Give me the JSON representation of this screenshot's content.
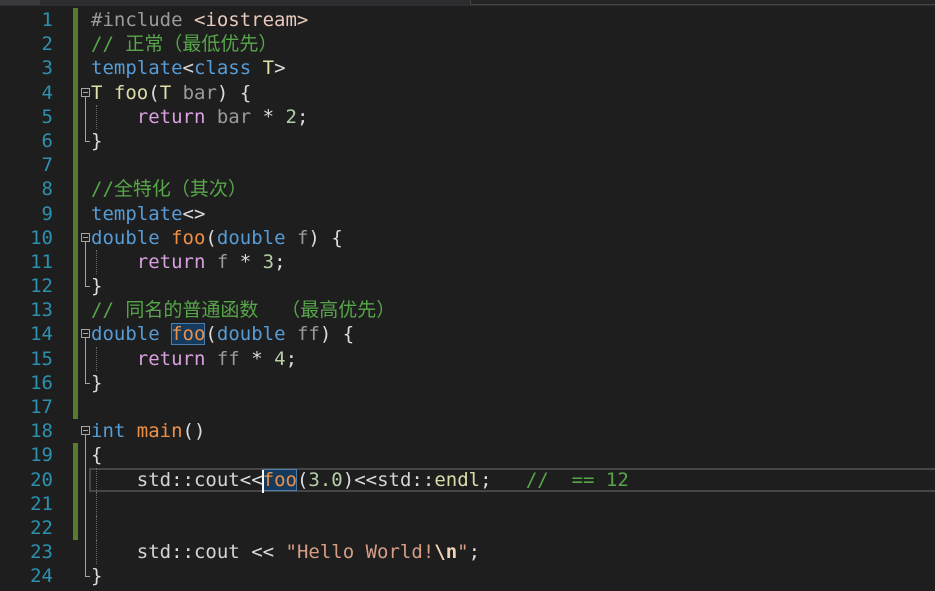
{
  "editor": {
    "lines": [
      {
        "num": "1",
        "changed": true,
        "tokens": [
          {
            "t": "#include",
            "c": "preproc"
          },
          {
            "t": " ",
            "c": "space"
          },
          {
            "t": "<iostream>",
            "c": "include"
          }
        ]
      },
      {
        "num": "2",
        "changed": true,
        "tokens": [
          {
            "t": "// 正常（最低优先）",
            "c": "comment"
          }
        ]
      },
      {
        "num": "3",
        "changed": true,
        "tokens": [
          {
            "t": "template",
            "c": "keyword"
          },
          {
            "t": "<",
            "c": "punct"
          },
          {
            "t": "class",
            "c": "keyword"
          },
          {
            "t": " ",
            "c": "space"
          },
          {
            "t": "T",
            "c": "typeparam"
          },
          {
            "t": ">",
            "c": "punct"
          }
        ]
      },
      {
        "num": "4",
        "changed": true,
        "outline": "start",
        "tokens": [
          {
            "t": "T",
            "c": "typeparam"
          },
          {
            "t": " ",
            "c": "space"
          },
          {
            "t": "foo",
            "c": "function"
          },
          {
            "t": "(",
            "c": "punct"
          },
          {
            "t": "T",
            "c": "typeparam"
          },
          {
            "t": " ",
            "c": "space"
          },
          {
            "t": "bar",
            "c": "param"
          },
          {
            "t": ")",
            "c": "punct"
          },
          {
            "t": " ",
            "c": "space"
          },
          {
            "t": "{",
            "c": "punct"
          }
        ]
      },
      {
        "num": "5",
        "changed": true,
        "outline": "mid",
        "guide": true,
        "tokens": [
          {
            "t": "    ",
            "c": "space"
          },
          {
            "t": "return",
            "c": "control"
          },
          {
            "t": " ",
            "c": "space"
          },
          {
            "t": "bar",
            "c": "param"
          },
          {
            "t": " ",
            "c": "space"
          },
          {
            "t": "*",
            "c": "punct"
          },
          {
            "t": " ",
            "c": "space"
          },
          {
            "t": "2",
            "c": "number"
          },
          {
            "t": ";",
            "c": "punct"
          }
        ]
      },
      {
        "num": "6",
        "changed": true,
        "outline": "end",
        "tokens": [
          {
            "t": "}",
            "c": "punct"
          }
        ]
      },
      {
        "num": "7",
        "changed": true,
        "tokens": []
      },
      {
        "num": "8",
        "changed": true,
        "tokens": [
          {
            "t": "//全特化（其次）",
            "c": "comment"
          }
        ]
      },
      {
        "num": "9",
        "changed": true,
        "tokens": [
          {
            "t": "template",
            "c": "keyword"
          },
          {
            "t": "<>",
            "c": "punct"
          }
        ]
      },
      {
        "num": "10",
        "changed": true,
        "outline": "start",
        "tokens": [
          {
            "t": "double",
            "c": "keyword"
          },
          {
            "t": " ",
            "c": "space"
          },
          {
            "t": "foo",
            "c": "user_function"
          },
          {
            "t": "(",
            "c": "punct"
          },
          {
            "t": "double",
            "c": "keyword"
          },
          {
            "t": " ",
            "c": "space"
          },
          {
            "t": "f",
            "c": "param"
          },
          {
            "t": ")",
            "c": "punct"
          },
          {
            "t": " ",
            "c": "space"
          },
          {
            "t": "{",
            "c": "punct"
          }
        ]
      },
      {
        "num": "11",
        "changed": true,
        "outline": "mid",
        "guide": true,
        "tokens": [
          {
            "t": "    ",
            "c": "space"
          },
          {
            "t": "return",
            "c": "control"
          },
          {
            "t": " ",
            "c": "space"
          },
          {
            "t": "f",
            "c": "param"
          },
          {
            "t": " ",
            "c": "space"
          },
          {
            "t": "*",
            "c": "punct"
          },
          {
            "t": " ",
            "c": "space"
          },
          {
            "t": "3",
            "c": "number"
          },
          {
            "t": ";",
            "c": "punct"
          }
        ]
      },
      {
        "num": "12",
        "changed": true,
        "outline": "end",
        "tokens": [
          {
            "t": "}",
            "c": "punct"
          }
        ]
      },
      {
        "num": "13",
        "changed": true,
        "tokens": [
          {
            "t": "// 同名的普通函数  （最高优先）",
            "c": "comment"
          }
        ]
      },
      {
        "num": "14",
        "changed": true,
        "outline": "start",
        "tokens": [
          {
            "t": "double",
            "c": "keyword"
          },
          {
            "t": " ",
            "c": "space"
          },
          {
            "t": "foo",
            "c": "user_function",
            "highlight": true
          },
          {
            "t": "(",
            "c": "punct"
          },
          {
            "t": "double",
            "c": "keyword"
          },
          {
            "t": " ",
            "c": "space"
          },
          {
            "t": "ff",
            "c": "param"
          },
          {
            "t": ")",
            "c": "punct"
          },
          {
            "t": " ",
            "c": "space"
          },
          {
            "t": "{",
            "c": "punct"
          }
        ]
      },
      {
        "num": "15",
        "changed": true,
        "outline": "mid",
        "guide": true,
        "tokens": [
          {
            "t": "    ",
            "c": "space"
          },
          {
            "t": "return",
            "c": "control"
          },
          {
            "t": " ",
            "c": "space"
          },
          {
            "t": "ff",
            "c": "param"
          },
          {
            "t": " ",
            "c": "space"
          },
          {
            "t": "*",
            "c": "punct"
          },
          {
            "t": " ",
            "c": "space"
          },
          {
            "t": "4",
            "c": "number"
          },
          {
            "t": ";",
            "c": "punct"
          }
        ]
      },
      {
        "num": "16",
        "changed": true,
        "outline": "end",
        "tokens": [
          {
            "t": "}",
            "c": "punct"
          }
        ]
      },
      {
        "num": "17",
        "changed": true,
        "tokens": []
      },
      {
        "num": "18",
        "changed": false,
        "outline": "start",
        "tokens": [
          {
            "t": "int",
            "c": "keyword"
          },
          {
            "t": " ",
            "c": "space"
          },
          {
            "t": "main",
            "c": "user_function"
          },
          {
            "t": "()",
            "c": "punct"
          }
        ]
      },
      {
        "num": "19",
        "changed": true,
        "outline": "mid",
        "tokens": [
          {
            "t": "{",
            "c": "punct"
          }
        ]
      },
      {
        "num": "20",
        "changed": true,
        "outline": "mid",
        "guide": true,
        "current": true,
        "tokens": [
          {
            "t": "    ",
            "c": "space"
          },
          {
            "t": "std",
            "c": "ident"
          },
          {
            "t": "::",
            "c": "punct"
          },
          {
            "t": "cout",
            "c": "ident"
          },
          {
            "t": "<<",
            "c": "punct"
          },
          {
            "t": "foo",
            "c": "user_function",
            "highlight": true,
            "caret": true
          },
          {
            "t": "(",
            "c": "punct"
          },
          {
            "t": "3.0",
            "c": "number"
          },
          {
            "t": ")",
            "c": "punct"
          },
          {
            "t": "<<",
            "c": "punct"
          },
          {
            "t": "std",
            "c": "ident"
          },
          {
            "t": "::",
            "c": "punct"
          },
          {
            "t": "endl",
            "c": "function"
          },
          {
            "t": ";",
            "c": "punct"
          },
          {
            "t": "   ",
            "c": "space"
          },
          {
            "t": "//  == 12",
            "c": "comment"
          }
        ]
      },
      {
        "num": "21",
        "changed": true,
        "outline": "mid",
        "guide": true,
        "tokens": []
      },
      {
        "num": "22",
        "changed": true,
        "outline": "mid",
        "guide": true,
        "tokens": []
      },
      {
        "num": "23",
        "changed": false,
        "outline": "mid",
        "guide": true,
        "tokens": [
          {
            "t": "    ",
            "c": "space"
          },
          {
            "t": "std",
            "c": "ident"
          },
          {
            "t": "::",
            "c": "punct"
          },
          {
            "t": "cout",
            "c": "ident"
          },
          {
            "t": " ",
            "c": "space"
          },
          {
            "t": "<<",
            "c": "punct"
          },
          {
            "t": " ",
            "c": "space"
          },
          {
            "t": "\"Hello World!",
            "c": "string"
          },
          {
            "t": "\\n",
            "c": "escape"
          },
          {
            "t": "\"",
            "c": "string"
          },
          {
            "t": ";",
            "c": "punct"
          }
        ]
      },
      {
        "num": "24",
        "changed": false,
        "outline": "end",
        "tokens": [
          {
            "t": "}",
            "c": "punct"
          }
        ]
      }
    ]
  },
  "colors": {
    "background": "#1E1E1E",
    "line_number": "#2B91AF",
    "change_bar": "#587C2F",
    "fold_marker": "#A5A5A5",
    "indent_guide": "#6A6A6A",
    "current_line_border": "#464646",
    "reference_bg": "#163A5C",
    "reference_border": "#4A7DB0",
    "caret": "#FFFFFF",
    "preproc": "#9B9B9B",
    "include": "#E8C9BB",
    "comment": "#57A64A",
    "keyword": "#569CD6",
    "control": "#D8A0DF",
    "typeparam": "#E0E0A8",
    "function": "#DCDCAA",
    "user_function": "#EE8F46",
    "param": "#9A9A9A",
    "number": "#B5CEA8",
    "string": "#D69D85",
    "escape": "#F0D2B4",
    "punct": "#DCDCDC",
    "ident": "#D4D4D4",
    "space": "#DCDCDC"
  }
}
